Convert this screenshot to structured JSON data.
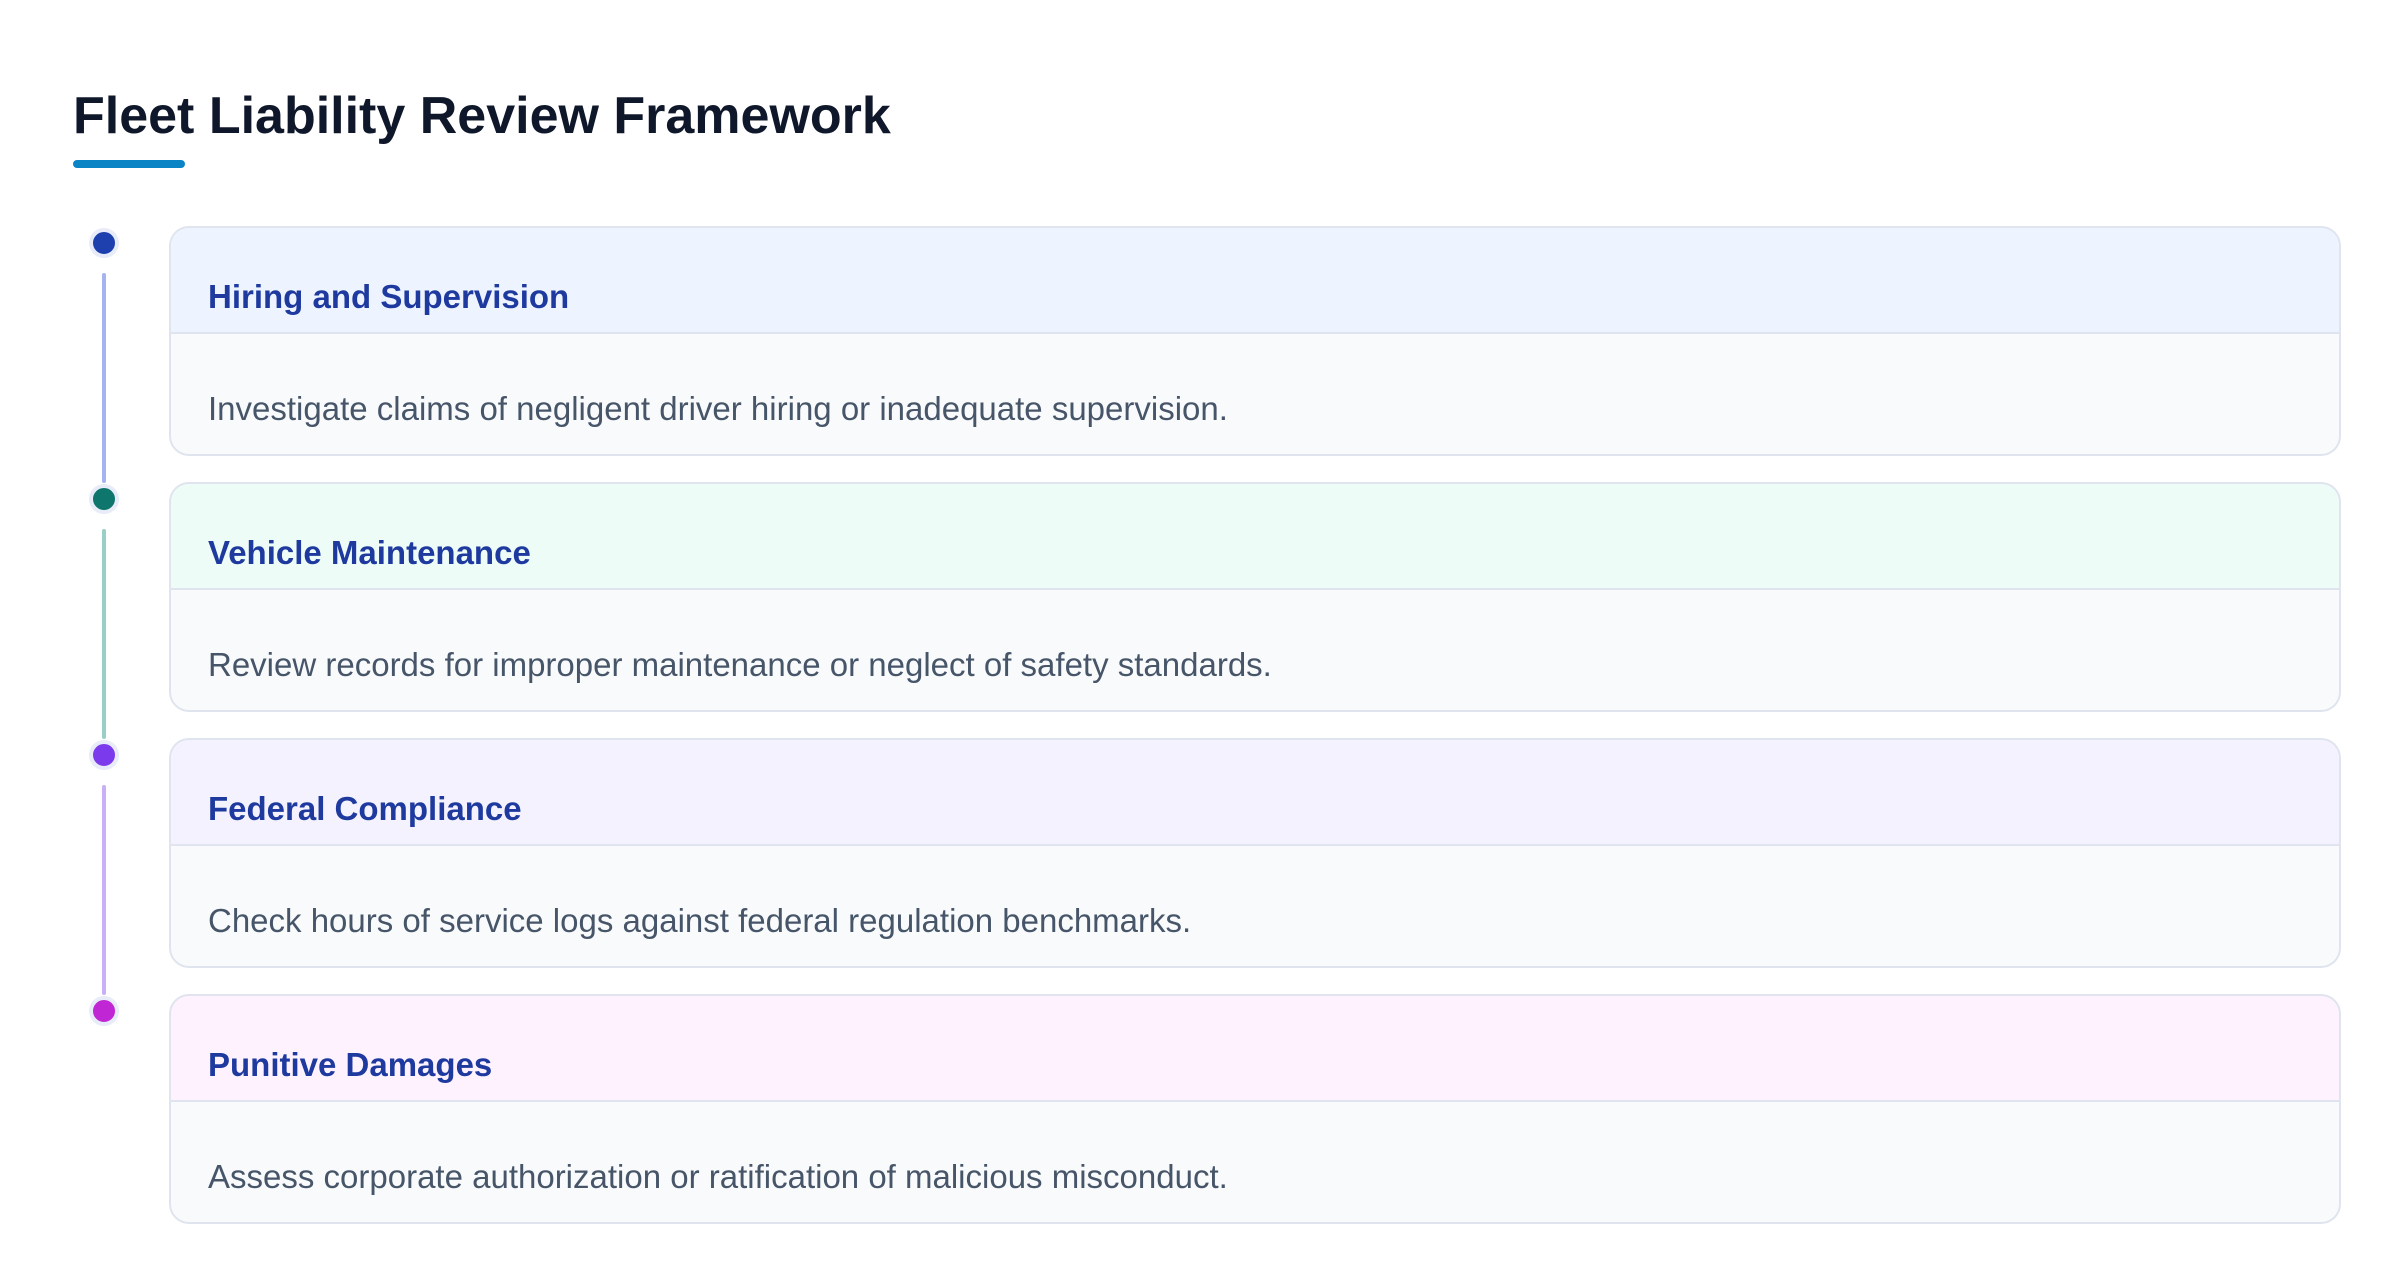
{
  "title": "Fleet Liability Review Framework",
  "accent_color": "#0b84c6",
  "steps": [
    {
      "title": "Hiring and Supervision",
      "description": "Investigate claims of negligent driver hiring or inadequate supervision.",
      "dot_color": "#1e40af",
      "line_color": "#a5b4f0",
      "header_bg": "#eef4ff"
    },
    {
      "title": "Vehicle Maintenance",
      "description": "Review records for improper maintenance or neglect of safety standards.",
      "dot_color": "#0f766e",
      "line_color": "#99cfc6",
      "header_bg": "#eefcf8"
    },
    {
      "title": "Federal Compliance",
      "description": "Check hours of service logs against federal regulation benchmarks.",
      "dot_color": "#7c3aed",
      "line_color": "#c8b0f6",
      "header_bg": "#f4f2fe"
    },
    {
      "title": "Punitive Damages",
      "description": "Assess corporate authorization or ratification of malicious misconduct.",
      "dot_color": "#c026d3",
      "line_color": "#efb7f5",
      "header_bg": "#fdf2fe"
    }
  ]
}
